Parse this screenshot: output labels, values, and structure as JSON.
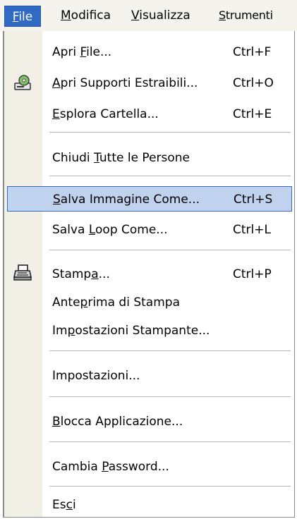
{
  "menubar": {
    "items": [
      {
        "label": "File",
        "ul": "F",
        "rest": "ile"
      },
      {
        "label": "Modifica",
        "ul": "M",
        "rest": "odifica"
      },
      {
        "label": "Visualizza",
        "ul": "V",
        "rest": "isualizza"
      },
      {
        "label": "Strumenti",
        "ul": "S",
        "rest": "trumenti"
      }
    ]
  },
  "menu": {
    "items": [
      {
        "pre": "Apri ",
        "ul": "F",
        "post": "ile...",
        "shortcut": "Ctrl+F"
      },
      {
        "pre": "",
        "ul": "A",
        "post": "pri Supporti Estraibili...",
        "shortcut": "Ctrl+O"
      },
      {
        "pre": "",
        "ul": "E",
        "post": "splora Cartella...",
        "shortcut": "Ctrl+E"
      },
      {
        "pre": "Chiudi ",
        "ul": "T",
        "post": "utte le Persone",
        "shortcut": ""
      },
      {
        "pre": "",
        "ul": "S",
        "post": "alva Immagine Come...",
        "shortcut": "Ctrl+S"
      },
      {
        "pre": "Salva ",
        "ul": "L",
        "post": "oop Come...",
        "shortcut": "Ctrl+L"
      },
      {
        "pre": "Stamp",
        "ul": "a",
        "post": "...",
        "shortcut": "Ctrl+P"
      },
      {
        "pre": "Ante",
        "ul": "p",
        "post": "rima di Stampa",
        "shortcut": ""
      },
      {
        "pre": "Im",
        "ul": "p",
        "post": "ostazioni Stampante...",
        "shortcut": ""
      },
      {
        "pre": "Impostazioni...",
        "ul": "",
        "post": "",
        "shortcut": ""
      },
      {
        "pre": "",
        "ul": "B",
        "post": "locca Applicazione...",
        "shortcut": ""
      },
      {
        "pre": "Cambia ",
        "ul": "P",
        "post": "assword...",
        "shortcut": ""
      },
      {
        "pre": "Es",
        "ul": "c",
        "post": "i",
        "shortcut": ""
      }
    ]
  },
  "colors": {
    "highlight": "#c1d2ee",
    "highlight_border": "#316ac5",
    "active_menu": "#316ac5"
  },
  "icons": {
    "removable_media": "disc-drive-icon",
    "print": "printer-icon"
  }
}
